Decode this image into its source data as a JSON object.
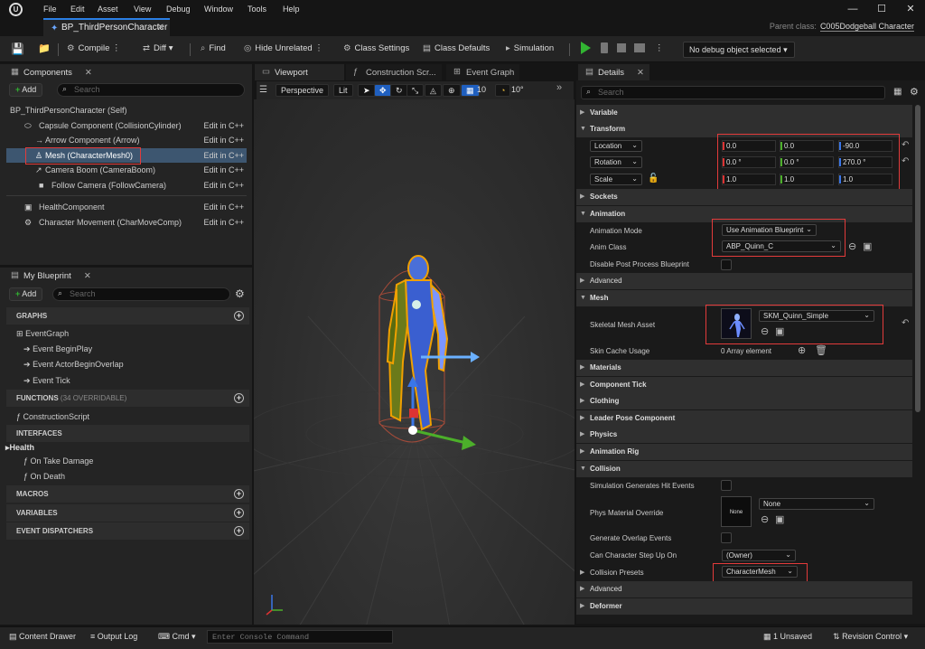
{
  "menu": {
    "items": [
      "File",
      "Edit",
      "Asset",
      "View",
      "Debug",
      "Window",
      "Tools",
      "Help"
    ]
  },
  "document_tab": {
    "title": "BP_ThirdPersonCharacter"
  },
  "parent_class": {
    "label": "Parent class:",
    "value": "C005Dodgeball Character"
  },
  "toolbar": {
    "compile": "Compile",
    "diff": "Diff",
    "find": "Find",
    "hide_unrelated": "Hide Unrelated",
    "class_settings": "Class Settings",
    "class_defaults": "Class Defaults",
    "simulation": "Simulation",
    "debug_object": "No debug object selected"
  },
  "components": {
    "tab": "Components",
    "add": "Add",
    "search_placeholder": "Search",
    "items": [
      {
        "label": "BP_ThirdPersonCharacter (Self)",
        "edit": ""
      },
      {
        "label": "Capsule Component (CollisionCylinder)",
        "edit": "Edit in C++"
      },
      {
        "label": "Arrow Component (Arrow)",
        "edit": "Edit in C++"
      },
      {
        "label": "Mesh (CharacterMesh0)",
        "edit": "Edit in C++"
      },
      {
        "label": "Camera Boom (CameraBoom)",
        "edit": "Edit in C++"
      },
      {
        "label": "Follow Camera (FollowCamera)",
        "edit": "Edit in C++"
      },
      {
        "label": "HealthComponent",
        "edit": "Edit in C++"
      },
      {
        "label": "Character Movement (CharMoveComp)",
        "edit": "Edit in C++"
      }
    ]
  },
  "my_blueprint": {
    "tab": "My Blueprint",
    "add": "Add",
    "search_placeholder": "Search",
    "graphs": "GRAPHS",
    "event_graph": "EventGraph",
    "events": [
      "Event BeginPlay",
      "Event ActorBeginOverlap",
      "Event Tick"
    ],
    "functions": "FUNCTIONS",
    "functions_note": "(34 OVERRIDABLE)",
    "construction_script": "ConstructionScript",
    "interfaces": "INTERFACES",
    "health": "Health",
    "interface_items": [
      "On Take Damage",
      "On Death"
    ],
    "macros": "MACROS",
    "variables": "VARIABLES",
    "event_dispatchers": "EVENT DISPATCHERS"
  },
  "editor_tabs": {
    "viewport": "Viewport",
    "construction": "Construction Scr...",
    "event_graph": "Event Graph"
  },
  "viewport": {
    "perspective": "Perspective",
    "lit": "Lit",
    "grid_snap": "10",
    "rot_snap": "10°"
  },
  "details": {
    "tab": "Details",
    "search_placeholder": "Search",
    "sections": {
      "variable": "Variable",
      "transform": "Transform",
      "sockets": "Sockets",
      "animation": "Animation",
      "advanced": "Advanced",
      "mesh": "Mesh",
      "materials": "Materials",
      "component_tick": "Component Tick",
      "clothing": "Clothing",
      "leader_pose": "Leader Pose Component",
      "physics": "Physics",
      "animation_rig": "Animation Rig",
      "collision": "Collision",
      "advanced2": "Advanced",
      "deformer": "Deformer"
    },
    "transform": {
      "location": {
        "label": "Location",
        "x": "0.0",
        "y": "0.0",
        "z": "-90.0"
      },
      "rotation": {
        "label": "Rotation",
        "x": "0.0 °",
        "y": "0.0 °",
        "z": "270.0 °"
      },
      "scale": {
        "label": "Scale",
        "x": "1.0",
        "y": "1.0",
        "z": "1.0"
      }
    },
    "animation": {
      "mode_label": "Animation Mode",
      "mode_value": "Use Animation Blueprint",
      "class_label": "Anim Class",
      "class_value": "ABP_Quinn_C",
      "disable_pp": "Disable Post Process Blueprint"
    },
    "mesh": {
      "asset_label": "Skeletal Mesh Asset",
      "asset_value": "SKM_Quinn_Simple",
      "skin_cache": "Skin Cache Usage",
      "skin_cache_value": "0 Array element"
    },
    "collision": {
      "sim_hit": "Simulation Generates Hit Events",
      "phys_mat": "Phys Material Override",
      "phys_mat_thumb": "None",
      "phys_mat_value": "None",
      "gen_overlap": "Generate Overlap Events",
      "step_up": "Can Character Step Up On",
      "step_up_value": "(Owner)",
      "presets": "Collision Presets",
      "presets_value": "CharacterMesh"
    }
  },
  "statusbar": {
    "content_drawer": "Content Drawer",
    "output_log": "Output Log",
    "cmd": "Cmd",
    "console_placeholder": "Enter Console Command",
    "unsaved": "1 Unsaved",
    "revision": "Revision Control"
  }
}
